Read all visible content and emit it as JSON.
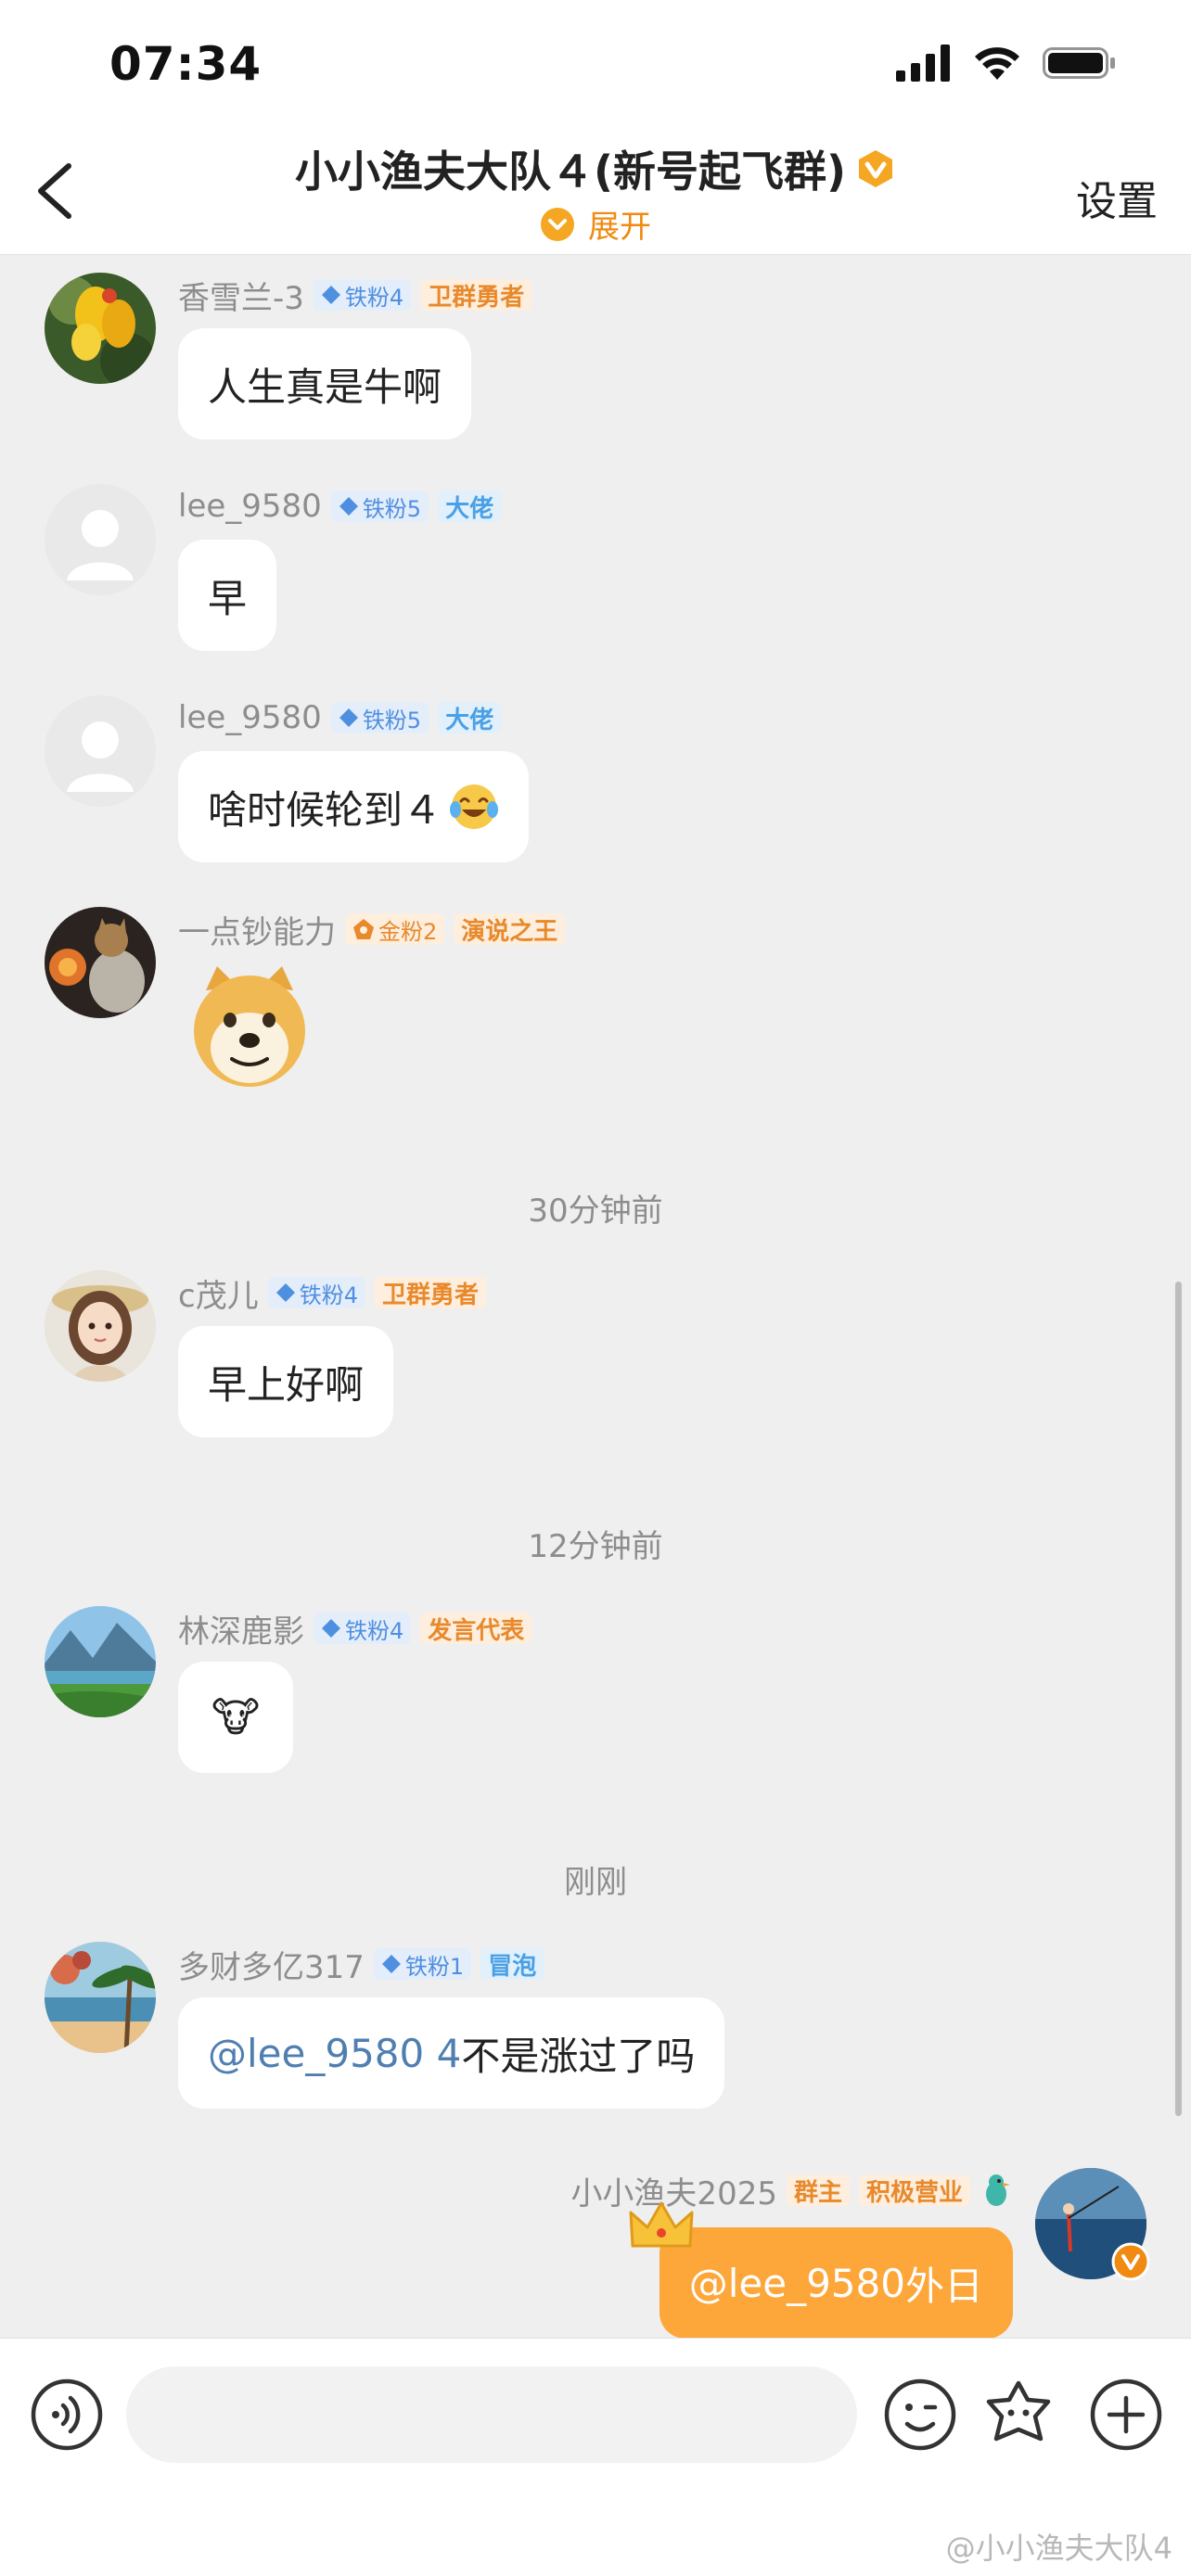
{
  "status": {
    "time": "07:34"
  },
  "nav": {
    "title": "小小渔夫大队４(新号起飞群)",
    "expand": "展开",
    "settings": "设置"
  },
  "messages": [
    {
      "user": "香雪兰-3",
      "fan": "铁粉4",
      "title": "卫群勇者",
      "text": "人生真是牛啊"
    },
    {
      "user": "lee_9580",
      "fan": "铁粉5",
      "title": "大佬",
      "text": "早"
    },
    {
      "user": "lee_9580",
      "fan": "铁粉5",
      "title": "大佬",
      "text": "啥时候轮到４"
    },
    {
      "user": "一点钞能力",
      "fan": "金粉2",
      "title": "演说之王",
      "text": ""
    },
    {
      "user": "c茂儿",
      "fan": "铁粉4",
      "title": "卫群勇者",
      "text": "早上好啊"
    },
    {
      "user": "林深鹿影",
      "fan": "铁粉4",
      "title": "发言代表",
      "text": "🐮"
    },
    {
      "user": "多财多亿317",
      "fan": "铁粉1",
      "title": "冒泡",
      "mention": "@lee_9580 4",
      "text": "不是涨过了吗"
    },
    {
      "user": "小小渔夫2025",
      "title": "群主",
      "title2": "积极营业",
      "mention": "@lee_9580",
      "text": " 外日"
    }
  ],
  "timestamps": [
    "30分钟前",
    "12分钟前",
    "刚刚"
  ],
  "input": {
    "placeholder": ""
  },
  "watermark": "@小小渔夫大队4"
}
